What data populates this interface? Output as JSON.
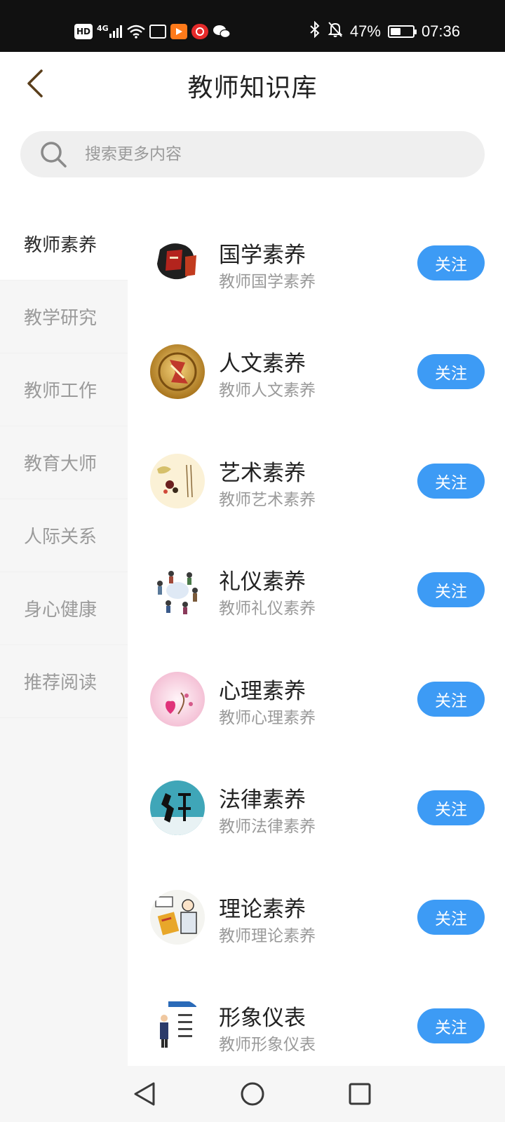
{
  "status_bar": {
    "left_icons": [
      "hd-icon",
      "signal-4g-icon",
      "wifi-icon",
      "mail-app-icon",
      "video-app-icon",
      "bank-app-icon",
      "wechat-icon"
    ],
    "hd_label": "HD",
    "network_label": "4G",
    "right_icons": [
      "bluetooth-icon",
      "bell-muted-icon"
    ],
    "battery_percent_label": "47%",
    "battery_level": 0.47,
    "time": "07:36"
  },
  "header": {
    "title": "教师知识库",
    "back_icon": "chevron-left-icon"
  },
  "search": {
    "placeholder": "搜索更多内容",
    "icon": "search-icon"
  },
  "sidebar": {
    "active_index": 0,
    "items": [
      {
        "label": "教师素养"
      },
      {
        "label": "教学研究"
      },
      {
        "label": "教师工作"
      },
      {
        "label": "教育大师"
      },
      {
        "label": "人际关系"
      },
      {
        "label": "身心健康"
      },
      {
        "label": "推荐阅读"
      }
    ]
  },
  "list": {
    "items": [
      {
        "title": "国学素养",
        "subtitle": "教师国学素养",
        "follow_label": "关注",
        "thumb": "guoxue-thumbnail-icon"
      },
      {
        "title": "人文素养",
        "subtitle": "教师人文素养",
        "follow_label": "关注",
        "thumb": "renwen-thumbnail-icon"
      },
      {
        "title": "艺术素养",
        "subtitle": "教师艺术素养",
        "follow_label": "关注",
        "thumb": "yishu-thumbnail-icon"
      },
      {
        "title": "礼仪素养",
        "subtitle": "教师礼仪素养",
        "follow_label": "关注",
        "thumb": "liyi-thumbnail-icon"
      },
      {
        "title": "心理素养",
        "subtitle": "教师心理素养",
        "follow_label": "关注",
        "thumb": "xinli-thumbnail-icon"
      },
      {
        "title": "法律素养",
        "subtitle": "教师法律素养",
        "follow_label": "关注",
        "thumb": "falv-thumbnail-icon"
      },
      {
        "title": "理论素养",
        "subtitle": "教师理论素养",
        "follow_label": "关注",
        "thumb": "lilun-thumbnail-icon"
      },
      {
        "title": "形象仪表",
        "subtitle": "教师形象仪表",
        "follow_label": "关注",
        "thumb": "xingxiang-thumbnail-icon"
      }
    ]
  },
  "nav_bar": {
    "buttons": [
      "back-triangle-icon",
      "home-circle-icon",
      "recents-square-icon"
    ]
  },
  "colors": {
    "accent": "#3d9bf5",
    "back_arrow": "#5a3e1b",
    "sidebar_bg": "#f6f6f6",
    "status_bar_bg": "#111111"
  }
}
